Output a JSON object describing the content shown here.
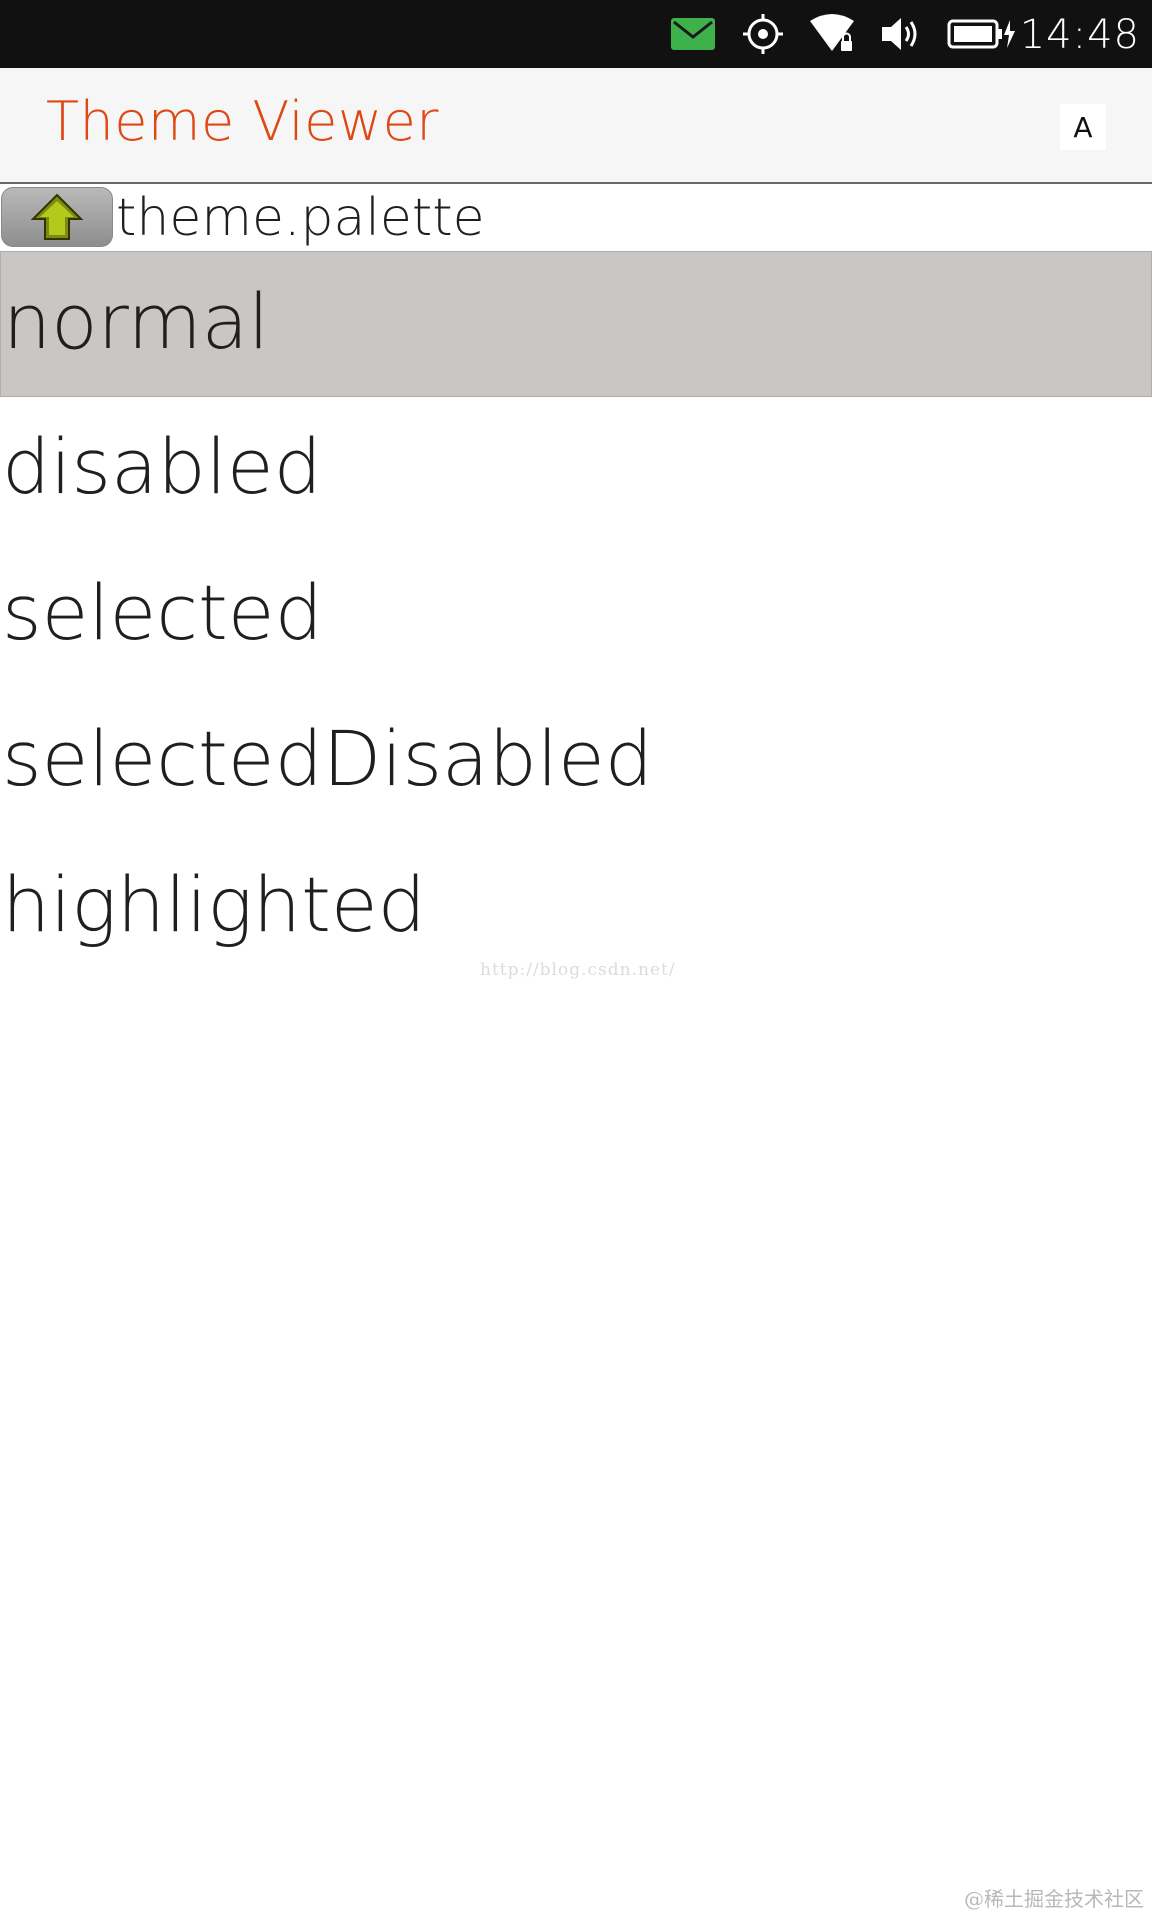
{
  "status_bar": {
    "time": "14:48",
    "icons": [
      "message-icon",
      "location-icon",
      "wifi-icon",
      "volume-icon",
      "battery-charging-icon"
    ],
    "message_icon_color": "#3fb14a"
  },
  "header": {
    "title": "Theme Viewer",
    "title_color": "#dd4814",
    "action_label": "A"
  },
  "path": {
    "label": "theme.palette",
    "up_icon": "up-arrow-icon"
  },
  "list": {
    "items": [
      {
        "label": "normal",
        "selected": true
      },
      {
        "label": "disabled",
        "selected": false
      },
      {
        "label": "selected",
        "selected": false
      },
      {
        "label": "selectedDisabled",
        "selected": false
      },
      {
        "label": "highlighted",
        "selected": false
      }
    ]
  },
  "watermarks": {
    "url": "http://blog.csdn.net/",
    "site": "@稀土掘金技术社区"
  }
}
